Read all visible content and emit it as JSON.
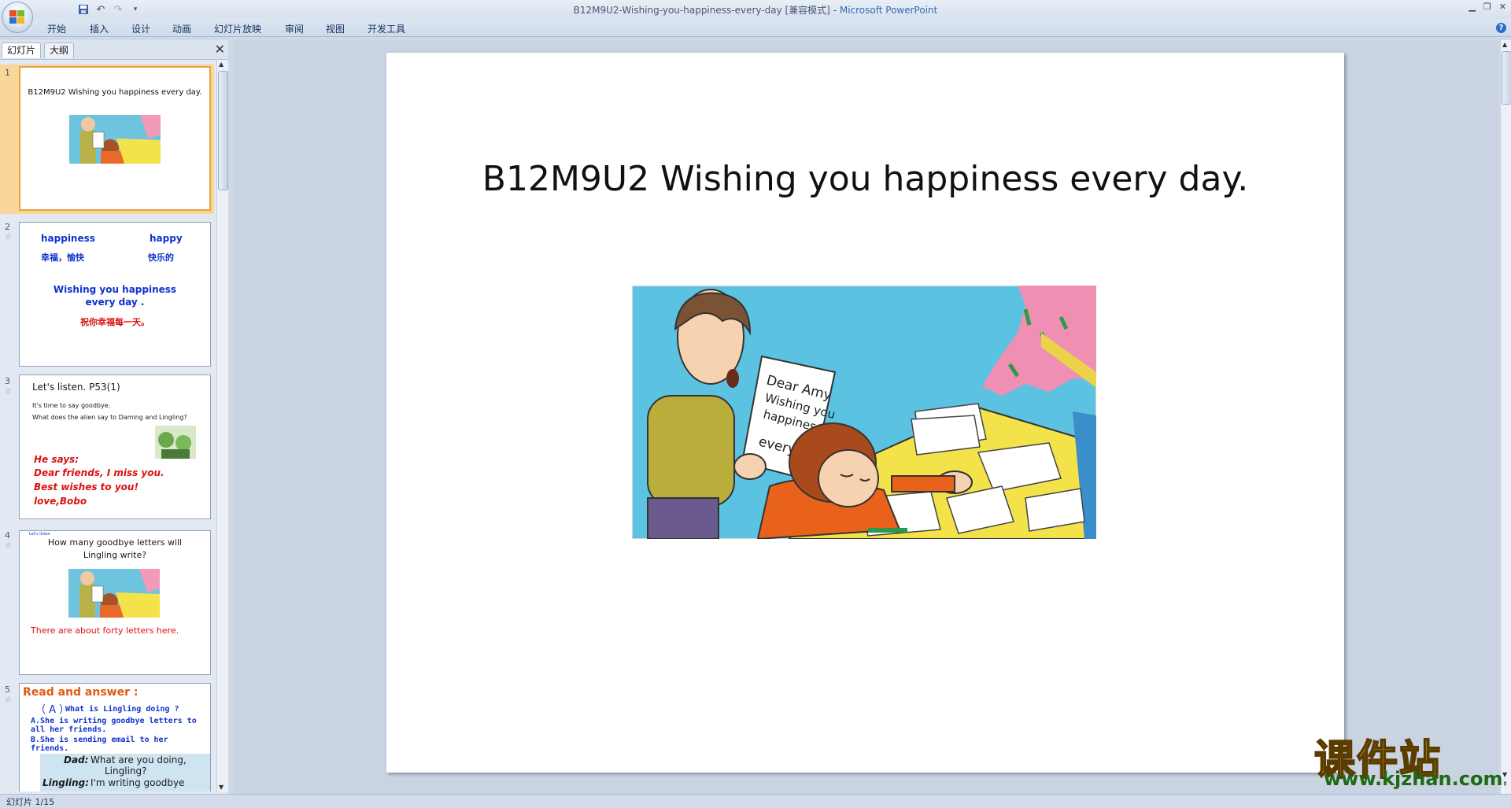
{
  "window": {
    "title": "B12M9U2-Wishing-you-happiness-every-day [兼容模式]",
    "app_name": "Microsoft PowerPoint",
    "separator": " - "
  },
  "ribbon_tabs": [
    "开始",
    "插入",
    "设计",
    "动画",
    "幻灯片放映",
    "审阅",
    "视图",
    "开发工具"
  ],
  "panel_tabs": {
    "slides": "幻灯片",
    "outline": "大纲"
  },
  "thumbnails": {
    "s1": {
      "num": "1",
      "title": "B12M9U2  Wishing you happiness every day."
    },
    "s2": {
      "num": "2",
      "word1": "happiness",
      "word2": "happy",
      "cn1": "幸福，愉快",
      "cn2": "快乐的",
      "phrase1": "Wishing  you  happiness",
      "phrase2": "every  day .",
      "cn_phrase": "祝你幸福每一天。"
    },
    "s3": {
      "num": "3",
      "heading": "Let's listen. P53(1)",
      "line1": "It's time to say goodbye.",
      "line2": "What does the alien say to Daming and Lingling?",
      "says": "He says:",
      "l1": "Dear friends, I miss you.",
      "l2": "Best wishes to you!",
      "l3": "love,Bobo"
    },
    "s4": {
      "num": "4",
      "tiny": "Let's listen",
      "q1": "How many goodbye letters will",
      "q2": "Lingling write?",
      "answer": "There are about forty letters here."
    },
    "s5": {
      "num": "5",
      "heading": "Read and  answer :",
      "choice": "（ A ）",
      "question": "What  is  Lingling  doing ?",
      "a1": "A.She is writing goodbye letters to",
      "a1b": "all her friends.",
      "b1": "B.She is sending email to her",
      "b1b": "friends.",
      "dad": "Dad:",
      "dad_line": "What are you doing,",
      "dad_line2": "Lingling?",
      "ling": "Lingling:",
      "ling_line": "I'm writing goodbye"
    }
  },
  "slide": {
    "title": "B12M9U2  Wishing you happiness every day.",
    "letter_lines": [
      "Dear Amy",
      "Wishing you",
      "happiness",
      "every day."
    ]
  },
  "status": "幻灯片 1/15",
  "watermark": {
    "cn": "课件站",
    "url": "www.kjzhan.com"
  },
  "icons": [
    "office-button-icon",
    "save-icon",
    "undo-icon",
    "redo-icon",
    "customize-icon",
    "help-icon",
    "close-icon"
  ]
}
